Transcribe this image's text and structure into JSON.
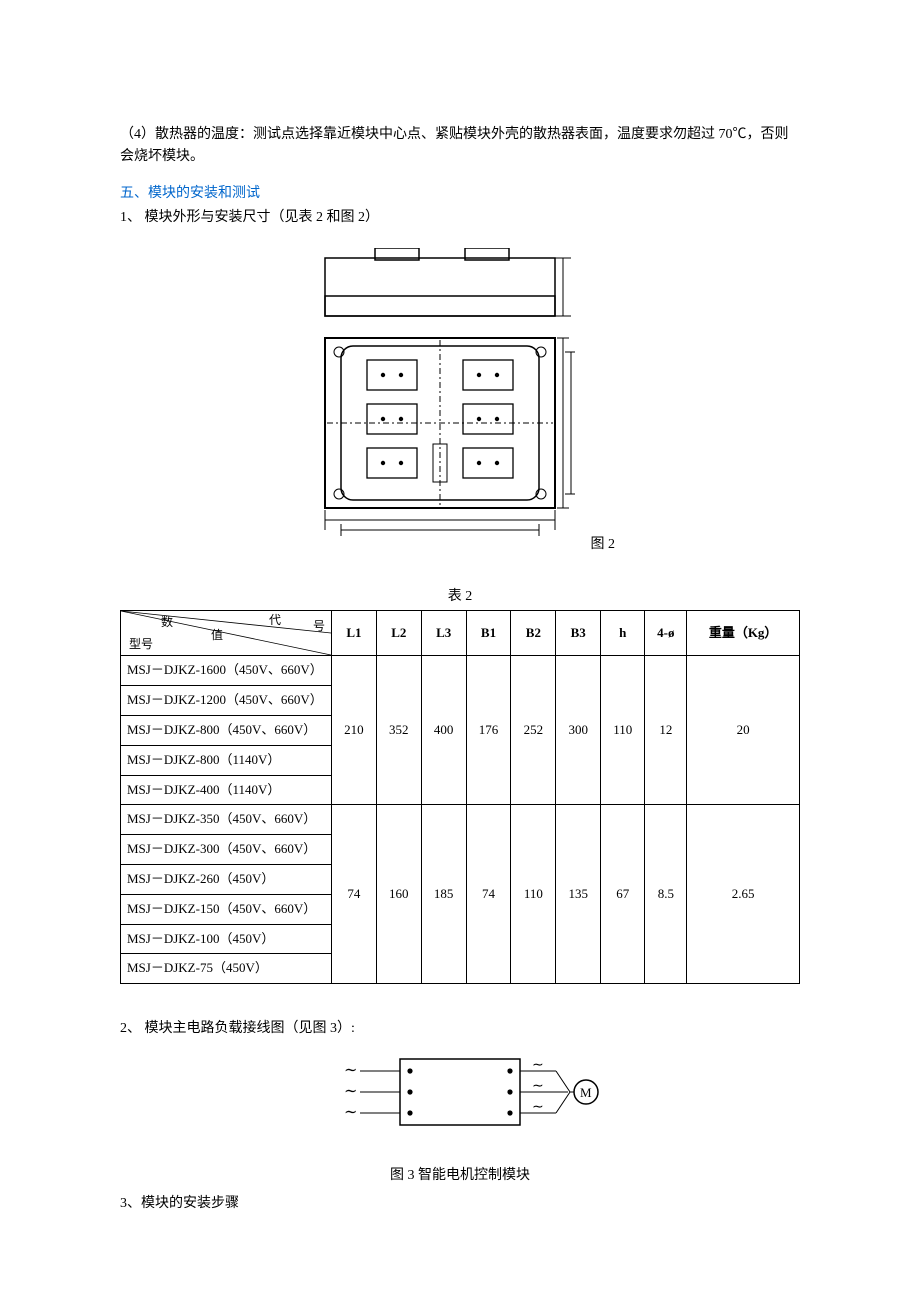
{
  "para4": "（4）散热器的温度：测试点选择靠近模块中心点、紧贴模块外壳的散热器表面，温度要求勿超过 70℃，否则会烧坏模块。",
  "heading5": "五、模块的安装和测试",
  "item1": "1、 模块外形与安装尺寸（见表 2 和图 2）",
  "fig2_label": "图 2",
  "table2_caption": "表 2",
  "table2": {
    "corner": {
      "shu": "数",
      "dai": "代",
      "hao": "号",
      "zhi": "值",
      "xinghao": "型号"
    },
    "headers": [
      "L1",
      "L2",
      "L3",
      "B1",
      "B2",
      "B3",
      "h",
      "4-ø",
      "重量（Kg）"
    ],
    "group1_models": [
      "MSJ－DJKZ-1600（450V、660V）",
      "MSJ－DJKZ-1200（450V、660V）",
      "MSJ－DJKZ-800（450V、660V）",
      "MSJ－DJKZ-800（1140V）",
      "MSJ－DJKZ-400（1140V）"
    ],
    "group1_values": [
      "210",
      "352",
      "400",
      "176",
      "252",
      "300",
      "110",
      "12",
      "20"
    ],
    "group2_models": [
      "MSJ－DJKZ-350（450V、660V）",
      "MSJ－DJKZ-300（450V、660V）",
      "MSJ－DJKZ-260（450V）",
      "MSJ－DJKZ-150（450V、660V）",
      "MSJ－DJKZ-100（450V）",
      "MSJ－DJKZ-75（450V）"
    ],
    "group2_values": [
      "74",
      "160",
      "185",
      "74",
      "110",
      "135",
      "67",
      "8.5",
      "2.65"
    ]
  },
  "item2": "2、 模块主电路负载接线图（见图 3）:",
  "fig3_caption": "图 3  智能电机控制模块",
  "item3": "3、模块的安装步骤"
}
